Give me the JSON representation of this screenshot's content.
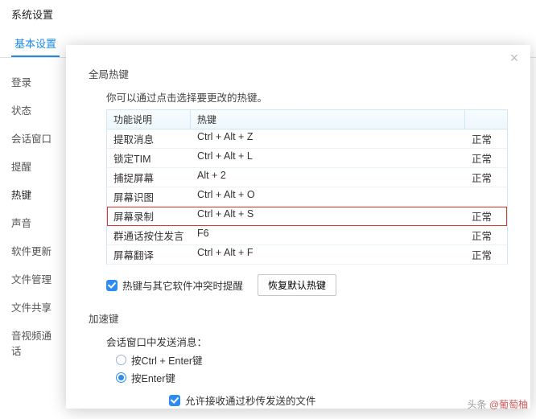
{
  "window": {
    "title": "系统设置"
  },
  "tabs": {
    "basic": "基本设置"
  },
  "sidebar": [
    {
      "label": "登录"
    },
    {
      "label": "状态"
    },
    {
      "label": "会话窗口"
    },
    {
      "label": "提醒"
    },
    {
      "label": "热键",
      "active": true
    },
    {
      "label": "声音"
    },
    {
      "label": "软件更新"
    },
    {
      "label": "文件管理"
    },
    {
      "label": "文件共享"
    },
    {
      "label": "音视频通话"
    }
  ],
  "global": {
    "section_title": "全局热键",
    "hint": "你可以通过点击选择要更改的热键。",
    "headers": {
      "fn": "功能说明",
      "hk": "热键",
      "st": ""
    },
    "rows": [
      {
        "fn": "提取消息",
        "hk": "Ctrl + Alt + Z",
        "st": "正常"
      },
      {
        "fn": "锁定TIM",
        "hk": "Ctrl + Alt + L",
        "st": "正常"
      },
      {
        "fn": "捕捉屏幕",
        "hk": "Alt + 2",
        "st": "正常"
      },
      {
        "fn": "屏幕识图",
        "hk": "Ctrl + Alt + O",
        "st": ""
      },
      {
        "fn": "屏幕录制",
        "hk": "Ctrl + Alt + S",
        "st": "正常",
        "hi": true
      },
      {
        "fn": "群通话按住发言",
        "hk": "F6",
        "st": "正常"
      },
      {
        "fn": "屏幕翻译",
        "hk": "Ctrl + Alt + F",
        "st": "正常"
      }
    ],
    "conflict_label": "热键与其它软件冲突时提醒",
    "reset_btn": "恢复默认热键"
  },
  "accel": {
    "section_title": "加速键",
    "send_title": "会话窗口中发送消息：",
    "opt_ctrl": "按Ctrl + Enter键",
    "opt_enter": "按Enter键"
  },
  "bottom_check": "允许接收通过秒传发送的文件",
  "footer": {
    "prefix": "头条 ",
    "at": "@葡萄柚"
  }
}
